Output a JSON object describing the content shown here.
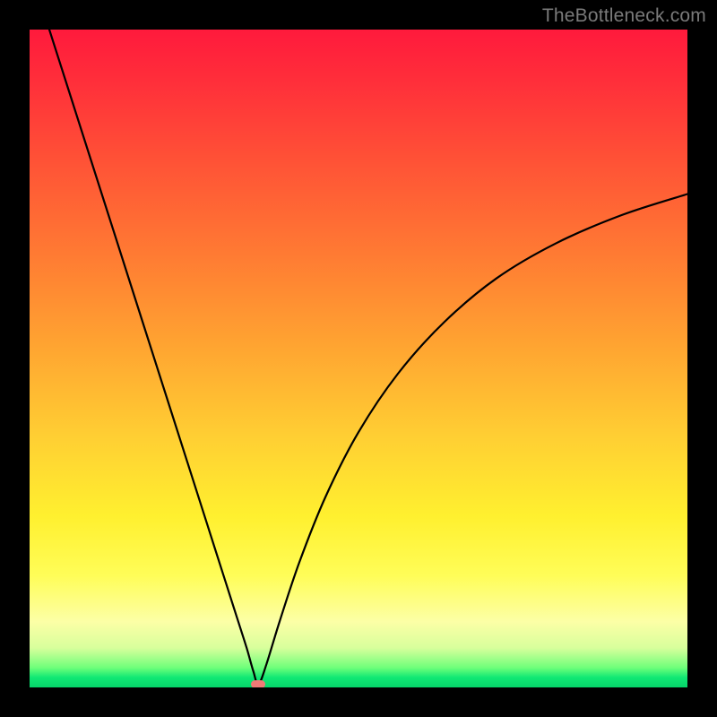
{
  "watermark": "TheBottleneck.com",
  "chart_data": {
    "type": "line",
    "title": "",
    "xlabel": "",
    "ylabel": "",
    "xlim": [
      0,
      100
    ],
    "ylim": [
      0,
      100
    ],
    "grid": false,
    "legend": false,
    "series": [
      {
        "name": "bottleneck-curve",
        "x": [
          3,
          6,
          9,
          12,
          15,
          18,
          21,
          24,
          27,
          30,
          31.5,
          33,
          34,
          34.8,
          36,
          38,
          41,
          45,
          50,
          56,
          63,
          71,
          80,
          90,
          100
        ],
        "y": [
          100,
          90.6,
          81.2,
          71.8,
          62.4,
          53.0,
          43.6,
          34.2,
          24.8,
          15.4,
          10.7,
          6.0,
          2.5,
          0.5,
          3.5,
          10.0,
          19.0,
          29.0,
          38.8,
          47.7,
          55.5,
          62.2,
          67.5,
          71.8,
          75.0
        ]
      }
    ],
    "annotations": [
      {
        "name": "min-marker",
        "x": 34.8,
        "y": 0.5,
        "color": "#ef7a76"
      }
    ],
    "background_gradient": {
      "direction": "vertical",
      "stops": [
        {
          "pos": 0.0,
          "color": "#ff1a3c"
        },
        {
          "pos": 0.5,
          "color": "#ffa431"
        },
        {
          "pos": 0.8,
          "color": "#fffd58"
        },
        {
          "pos": 0.97,
          "color": "#6fff7a"
        },
        {
          "pos": 1.0,
          "color": "#06d46a"
        }
      ]
    }
  }
}
